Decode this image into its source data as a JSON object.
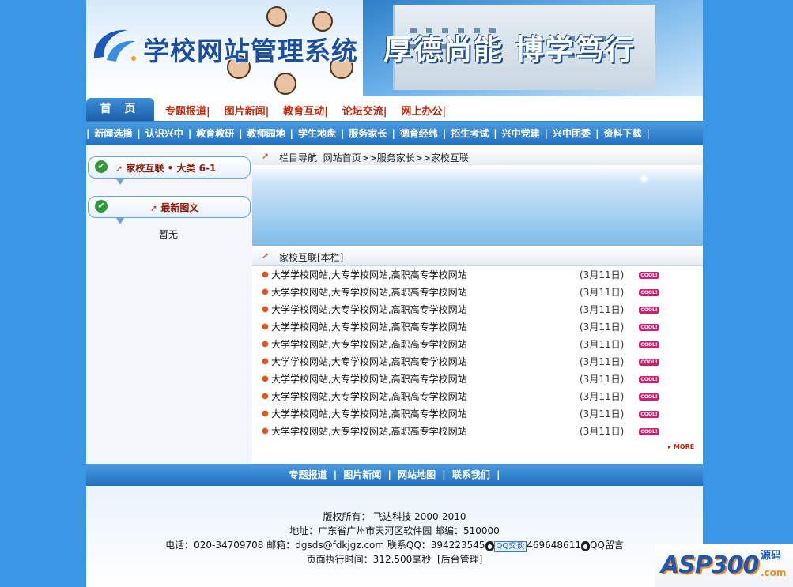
{
  "banner": {
    "title": "学校网站管理系统",
    "slogan": "厚德尚能  博学笃行"
  },
  "topnav": {
    "home": "首 页",
    "links": [
      "专题报道|",
      "图片新闻|",
      "教育互动|",
      "论坛交流|",
      "网上办公|"
    ]
  },
  "subnav": {
    "items": [
      "新闻选摘",
      "认识兴中",
      "教育教研",
      "教师园地",
      "学生地盘",
      "服务家长",
      "德育经纬",
      "招生考试",
      "兴中党建",
      "兴中团委",
      "资料下载"
    ]
  },
  "left": {
    "category_box": "家校互联 • 大类 6-1",
    "latest_box": "最新图文",
    "empty_text": "暂无"
  },
  "right": {
    "breadcrumb_label": "栏目导航",
    "breadcrumb_path": "网站首页>>服务家长>>家校互联",
    "section_title": "家校互联[本栏]",
    "articles": [
      {
        "title": "大学学校网站,大专学校网站,高职高专学校网站",
        "date": "(3月11日)"
      },
      {
        "title": "大学学校网站,大专学校网站,高职高专学校网站",
        "date": "(3月11日)"
      },
      {
        "title": "大学学校网站,大专学校网站,高职高专学校网站",
        "date": "(3月11日)"
      },
      {
        "title": "大学学校网站,大专学校网站,高职高专学校网站",
        "date": "(3月11日)"
      },
      {
        "title": "大学学校网站,大专学校网站,高职高专学校网站",
        "date": "(3月11日)"
      },
      {
        "title": "大学学校网站,大专学校网站,高职高专学校网站",
        "date": "(3月11日)"
      },
      {
        "title": "大学学校网站,大专学校网站,高职高专学校网站",
        "date": "(3月11日)"
      },
      {
        "title": "大学学校网站,大专学校网站,高职高专学校网站",
        "date": "(3月11日)"
      },
      {
        "title": "大学学校网站,大专学校网站,高职高专学校网站",
        "date": "(3月11日)"
      },
      {
        "title": "大学学校网站,大专学校网站,高职高专学校网站",
        "date": "(3月11日)"
      }
    ],
    "cool_badge": "COOL!",
    "more_label": "MORE"
  },
  "footer_nav": {
    "items": [
      "专题报道",
      "图片新闻",
      "网站地图",
      "联系我们"
    ]
  },
  "footer": {
    "copyright": "版权所有： 飞达科技 2000-2010",
    "address": "地址：广东省广州市天河区软件园 邮编：510000",
    "contact_prefix": "电话：020-34709708 邮箱：dgsds@fdkjgz.com 联系QQ：394223545",
    "qq_talk": "QQ交谈",
    "qq2": "469648611",
    "qq_msg": "QQ留言",
    "exec_time": "页面执行时间：312.500毫秒",
    "admin_link": "[后台管理]"
  },
  "watermark": {
    "brand": "ASP300",
    "cn": "源码",
    "domain": ".com"
  }
}
